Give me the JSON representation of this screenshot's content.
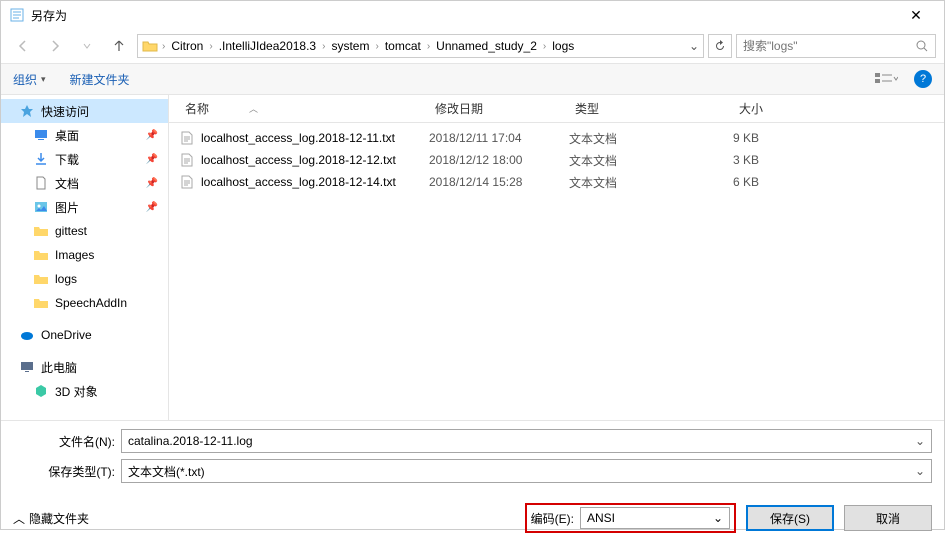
{
  "window": {
    "title": "另存为"
  },
  "breadcrumb": [
    "Citron",
    ".IntelliJIdea2018.3",
    "system",
    "tomcat",
    "Unnamed_study_2",
    "logs"
  ],
  "search": {
    "placeholder": "搜索\"logs\""
  },
  "toolbar": {
    "organize": "组织",
    "new_folder": "新建文件夹"
  },
  "sidebar": {
    "quick_access": "快速访问",
    "items": [
      {
        "label": "桌面",
        "pinned": true,
        "icon": "desktop"
      },
      {
        "label": "下载",
        "pinned": true,
        "icon": "download"
      },
      {
        "label": "文档",
        "pinned": true,
        "icon": "doc"
      },
      {
        "label": "图片",
        "pinned": true,
        "icon": "pic"
      },
      {
        "label": "gittest",
        "pinned": false,
        "icon": "folder"
      },
      {
        "label": "Images",
        "pinned": false,
        "icon": "folder"
      },
      {
        "label": "logs",
        "pinned": false,
        "icon": "folder"
      },
      {
        "label": "SpeechAddIn",
        "pinned": false,
        "icon": "folder"
      }
    ],
    "onedrive": "OneDrive",
    "this_pc": "此电脑",
    "objects3d": "3D 对象"
  },
  "columns": {
    "name": "名称",
    "date": "修改日期",
    "type": "类型",
    "size": "大小"
  },
  "files": [
    {
      "name": "localhost_access_log.2018-12-11.txt",
      "date": "2018/12/11 17:04",
      "type": "文本文档",
      "size": "9 KB"
    },
    {
      "name": "localhost_access_log.2018-12-12.txt",
      "date": "2018/12/12 18:00",
      "type": "文本文档",
      "size": "3 KB"
    },
    {
      "name": "localhost_access_log.2018-12-14.txt",
      "date": "2018/12/14 15:28",
      "type": "文本文档",
      "size": "6 KB"
    }
  ],
  "filename": {
    "label": "文件名(N):",
    "value": "catalina.2018-12-11.log"
  },
  "filetype": {
    "label": "保存类型(T):",
    "value": "文本文档(*.txt)"
  },
  "encoding": {
    "label": "编码(E):",
    "value": "ANSI"
  },
  "hide_folders": "隐藏文件夹",
  "buttons": {
    "save": "保存(S)",
    "cancel": "取消"
  }
}
